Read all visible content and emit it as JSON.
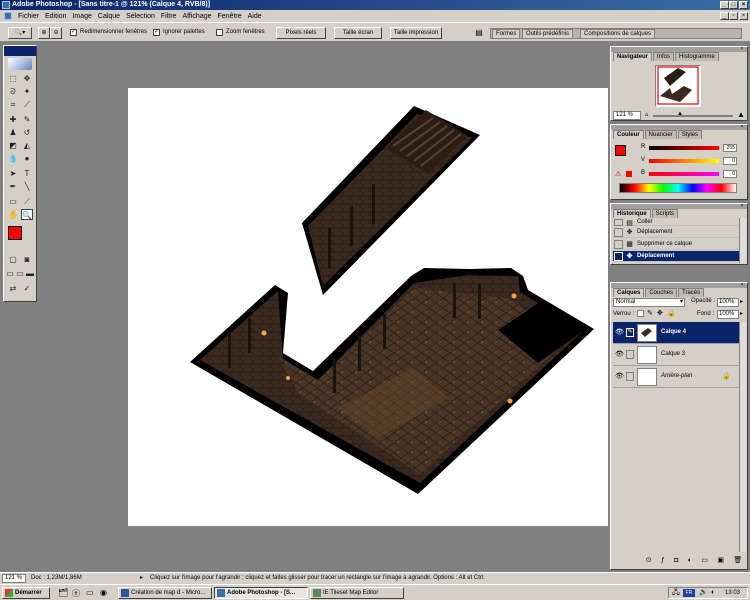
{
  "window": {
    "title": "Adobe Photoshop - [Sans titre-1 @ 121% (Calque 4, RVB/8)]"
  },
  "menu": [
    "Fichier",
    "Edition",
    "Image",
    "Calque",
    "Sélection",
    "Filtre",
    "Affichage",
    "Fenêtre",
    "Aide"
  ],
  "options": {
    "resize_windows": "Redimensionner fenêtres",
    "ignore_palettes": "Ignorer palettes",
    "zoom_windows": "Zoom fenêtres",
    "actual_pixels": "Pixels réels",
    "fit_screen": "Taille écran",
    "print_size": "Taille impression",
    "resize_windows_checked": true,
    "ignore_palettes_checked": true,
    "zoom_windows_checked": false
  },
  "well_tabs": [
    "Formes",
    "Outils prédéfinis",
    "Compositions de calques"
  ],
  "navigator": {
    "tabs": [
      "Navigateur",
      "Infos",
      "Histogramme"
    ],
    "zoom": "121 %"
  },
  "color": {
    "tabs": [
      "Couleur",
      "Nuancier",
      "Styles"
    ],
    "channels": [
      {
        "label": "R",
        "value": "255"
      },
      {
        "label": "V",
        "value": "0"
      },
      {
        "label": "B",
        "value": "0"
      }
    ],
    "foreground": "#ff0000",
    "background": "#ffffff"
  },
  "history": {
    "tabs": [
      "Historique",
      "Scripts"
    ],
    "items": [
      {
        "label": "Coller",
        "icon": "paste-icon"
      },
      {
        "label": "Déplacement",
        "icon": "move-icon"
      },
      {
        "label": "Supprimer ce calque",
        "icon": "layer-icon"
      },
      {
        "label": "Déplacement",
        "icon": "move-icon",
        "selected": true
      }
    ]
  },
  "layers": {
    "tabs": [
      "Calques",
      "Couches",
      "Tracés"
    ],
    "blend_mode": "Normal",
    "opacity_label": "Opacité :",
    "opacity": "100%",
    "lock_label": "Verrou :",
    "fill_label": "Fond :",
    "fill": "100%",
    "items": [
      {
        "name": "Calque 4",
        "selected": true
      },
      {
        "name": "Calque 3",
        "selected": false
      },
      {
        "name": "Arrière-plan",
        "selected": false,
        "italic": true
      }
    ]
  },
  "status": {
    "zoom": "121 %",
    "doc": "Doc : 1,23M/1,86M",
    "hint": "Cliquez sur l'image pour l'agrandir ; cliquez et faites glisser pour tracer un rectangle sur l'image à agrandir. Options : Alt et Ctrl."
  },
  "taskbar": {
    "start": "Démarrer",
    "tasks": [
      {
        "label": "Création de map d - Micro..."
      },
      {
        "label": "Adobe Photoshop - [S...",
        "active": true
      },
      {
        "label": "IE Tileset Map Editor"
      }
    ],
    "time": "13:03"
  },
  "colors": {
    "title_bar": "#0a246a",
    "chrome": "#d4d0c8",
    "workspace": "#808080",
    "selection": "#0a246a"
  }
}
